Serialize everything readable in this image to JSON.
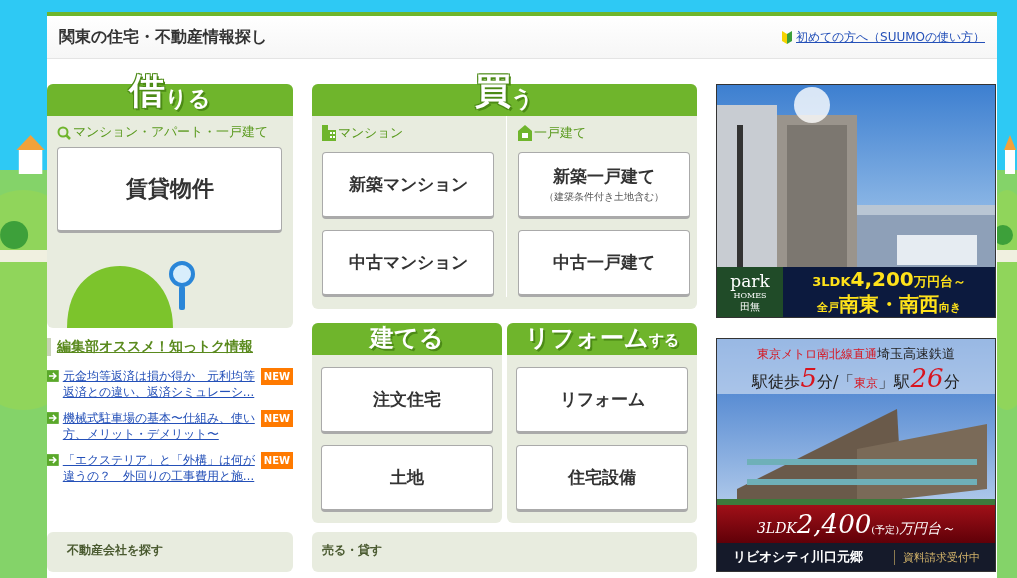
{
  "header": {
    "title": "関東の住宅・不動産情報探し",
    "help_link": "初めての方へ（SUUMOの使い方）"
  },
  "rent": {
    "heading_big": "借",
    "heading_small": "りる",
    "category": "マンション・アパート・一戸建て",
    "buttons": [
      {
        "label": "賃貸物件"
      }
    ]
  },
  "buy": {
    "heading_big": "買",
    "heading_small": "う",
    "columns": [
      {
        "label": "マンション",
        "kind": "building",
        "buttons": [
          {
            "label": "新築マンション"
          },
          {
            "label": "中古マンション"
          }
        ]
      },
      {
        "label": "一戸建て",
        "kind": "house",
        "buttons": [
          {
            "label": "新築一戸建て",
            "note": "（建築条件付き土地含む）"
          },
          {
            "label": "中古一戸建て"
          }
        ]
      }
    ]
  },
  "build": {
    "heading_big": "建てる",
    "buttons": [
      {
        "label": "注文住宅"
      },
      {
        "label": "土地"
      }
    ]
  },
  "reform": {
    "heading_big": "リフォーム",
    "heading_small": "する",
    "buttons": [
      {
        "label": "リフォーム"
      },
      {
        "label": "住宅設備"
      }
    ]
  },
  "news": {
    "heading": "編集部オススメ！知っトク情報",
    "items": [
      {
        "text": "元金均等返済は損か得か　元利均等返済との違い、返済シミュレーシ…",
        "badge": "NEW"
      },
      {
        "text": "機械式駐車場の基本〜仕組み、使い方、メリット・デメリット〜",
        "badge": "NEW"
      },
      {
        "text": "「エクステリア」と「外構」は何が違うの？　外回りの工事費用と施…",
        "badge": "NEW"
      }
    ]
  },
  "bottom_panels": [
    {
      "title": "不動産会社を探す"
    },
    {
      "title": "売る・貸す"
    }
  ],
  "ads": [
    {
      "kind": "tower",
      "logo": [
        "park",
        "HOMES",
        "田無"
      ],
      "lines": [
        [
          {
            "text": "3LDK",
            "kind": "plain"
          },
          {
            "text": "4,200",
            "kind": "big"
          },
          {
            "text": "万円台～",
            "kind": "plain"
          }
        ],
        [
          {
            "text": "全戸",
            "kind": "small"
          },
          {
            "text": "南東・南西",
            "kind": "big"
          },
          {
            "text": "向き",
            "kind": "small"
          }
        ]
      ]
    },
    {
      "kind": "slab",
      "top_lines": [
        [
          {
            "text": "東京メトロ南北線直通",
            "kind": "red"
          },
          {
            "text": "埼玉高速鉄道",
            "kind": "plain"
          }
        ],
        [
          {
            "text": "駅徒歩",
            "kind": "plain"
          },
          {
            "text": "5",
            "kind": "bigred"
          },
          {
            "text": "分/「",
            "kind": "plain"
          },
          {
            "text": "東京",
            "kind": "red"
          },
          {
            "text": "」駅",
            "kind": "plain"
          },
          {
            "text": "26",
            "kind": "bigred"
          },
          {
            "text": "分",
            "kind": "plain"
          }
        ]
      ],
      "lines": [
        [
          {
            "text": "3LDK",
            "kind": "plain"
          },
          {
            "text": "2,400",
            "kind": "big"
          },
          {
            "text": "(予定)",
            "kind": "small"
          },
          {
            "text": "万円台～",
            "kind": "plain"
          }
        ]
      ],
      "name": "リビオシティ川口元郷",
      "tag": "資料請求受付中"
    }
  ]
}
